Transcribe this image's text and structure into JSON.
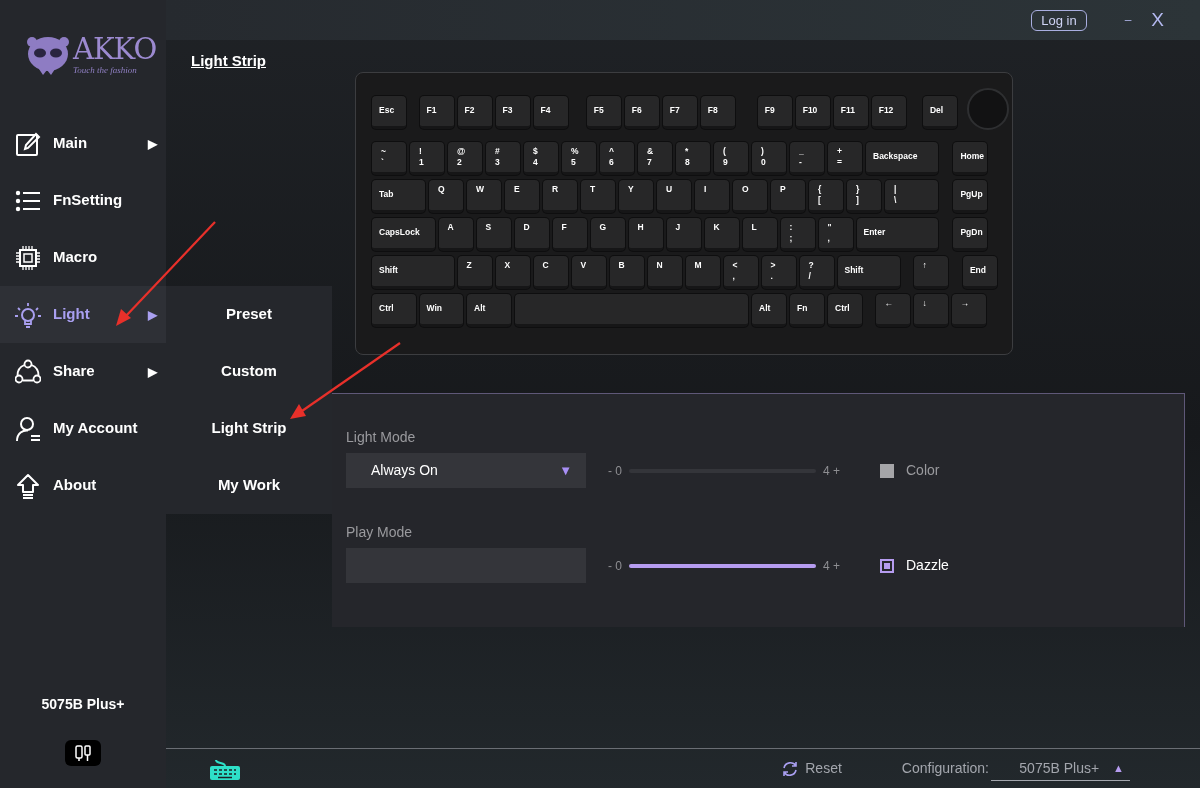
{
  "top_bar": {
    "login": "Log in",
    "minimize": "–",
    "close": "X"
  },
  "logo": {
    "brand": "AKKO",
    "tagline": "Touch the fashion"
  },
  "sidebar": {
    "items": [
      {
        "label": "Main",
        "kind": "edit",
        "arrow": "▶",
        "selected": false
      },
      {
        "label": "FnSetting",
        "kind": "list",
        "selected": false
      },
      {
        "label": "Macro",
        "kind": "chip",
        "selected": false
      },
      {
        "label": "Light",
        "kind": "bulb",
        "arrow": "▶",
        "selected": true
      },
      {
        "label": "Share",
        "kind": "share",
        "arrow": "▶",
        "selected": false
      },
      {
        "label": "My Account",
        "kind": "account",
        "selected": false
      },
      {
        "label": "About",
        "kind": "upload",
        "selected": false
      }
    ],
    "device": "5075B Plus+"
  },
  "submenu": {
    "items": [
      {
        "label": "Preset"
      },
      {
        "label": "Custom"
      },
      {
        "label": "Light Strip"
      },
      {
        "label": "My Work"
      }
    ]
  },
  "page_title": "Light Strip",
  "keyboard": {
    "rows": [
      {
        "keys": [
          {
            "label": "Esc"
          },
          {
            "label": "F1"
          },
          {
            "label": "F2"
          },
          {
            "label": "F3"
          },
          {
            "label": "F4"
          },
          {
            "label": "F5"
          },
          {
            "label": "F6"
          },
          {
            "label": "F7"
          },
          {
            "label": "F8"
          },
          {
            "label": "F9"
          },
          {
            "label": "F10"
          },
          {
            "label": "F11"
          },
          {
            "label": "F12"
          },
          {
            "label": "Del"
          }
        ]
      },
      {
        "keys": [
          {
            "upper": "~",
            "lower": "`"
          },
          {
            "upper": "!",
            "lower": "1"
          },
          {
            "upper": "@",
            "lower": "2"
          },
          {
            "upper": "#",
            "lower": "3"
          },
          {
            "upper": "$",
            "lower": "4"
          },
          {
            "upper": "%",
            "lower": "5"
          },
          {
            "upper": "^",
            "lower": "6"
          },
          {
            "upper": "&",
            "lower": "7"
          },
          {
            "upper": "*",
            "lower": "8"
          },
          {
            "upper": "(",
            "lower": "9"
          },
          {
            "upper": ")",
            "lower": "0"
          },
          {
            "upper": "_",
            "lower": "-"
          },
          {
            "upper": "+",
            "lower": "="
          },
          {
            "label": "Backspace"
          },
          {
            "label": "Home"
          }
        ]
      },
      {
        "keys": [
          {
            "label": "Tab"
          },
          {
            "label": "Q"
          },
          {
            "label": "W"
          },
          {
            "label": "E"
          },
          {
            "label": "R"
          },
          {
            "label": "T"
          },
          {
            "label": "Y"
          },
          {
            "label": "U"
          },
          {
            "label": "I"
          },
          {
            "label": "O"
          },
          {
            "label": "P"
          },
          {
            "upper": "{",
            "lower": "["
          },
          {
            "upper": "}",
            "lower": "]"
          },
          {
            "upper": "|",
            "lower": "\\"
          },
          {
            "label": "PgUp"
          }
        ]
      },
      {
        "keys": [
          {
            "label": "CapsLock"
          },
          {
            "label": "A"
          },
          {
            "label": "S"
          },
          {
            "label": "D"
          },
          {
            "label": "F"
          },
          {
            "label": "G"
          },
          {
            "label": "H"
          },
          {
            "label": "J"
          },
          {
            "label": "K"
          },
          {
            "label": "L"
          },
          {
            "upper": ":",
            "lower": ";"
          },
          {
            "upper": "\"",
            "lower": ","
          },
          {
            "label": "Enter"
          },
          {
            "label": "PgDn"
          }
        ]
      },
      {
        "keys": [
          {
            "label": "Shift"
          },
          {
            "label": "Z"
          },
          {
            "label": "X"
          },
          {
            "label": "C"
          },
          {
            "label": "V"
          },
          {
            "label": "B"
          },
          {
            "label": "N"
          },
          {
            "label": "M"
          },
          {
            "upper": "<",
            "lower": ","
          },
          {
            "upper": ">",
            "lower": "."
          },
          {
            "upper": "?",
            "lower": "/"
          },
          {
            "label": "Shift"
          },
          {
            "label": "↑"
          },
          {
            "label": "End"
          }
        ]
      },
      {
        "keys": [
          {
            "label": "Ctrl"
          },
          {
            "label": "Win"
          },
          {
            "label": "Alt"
          },
          {
            "label": "Alt"
          },
          {
            "label": "Fn"
          },
          {
            "label": "Ctrl"
          },
          {
            "label": "←"
          },
          {
            "label": "↓"
          },
          {
            "label": "→"
          }
        ]
      }
    ]
  },
  "panel": {
    "light_mode": {
      "label": "Light Mode",
      "value": "Always On",
      "arrow": "▼"
    },
    "play_mode": {
      "label": "Play Mode"
    },
    "sliders": [
      {
        "min": "- 0",
        "max": "4 +",
        "level": 0
      },
      {
        "min": "- 0",
        "max": "4 +",
        "level": 1
      }
    ],
    "options": [
      {
        "label": "Color",
        "checked": false
      },
      {
        "label": "Dazzle",
        "checked": true
      }
    ]
  },
  "status_bar": {
    "reset": "Reset",
    "configuration_label": "Configuration:",
    "configuration_value": "5075B Plus+",
    "arrow": "▲"
  }
}
